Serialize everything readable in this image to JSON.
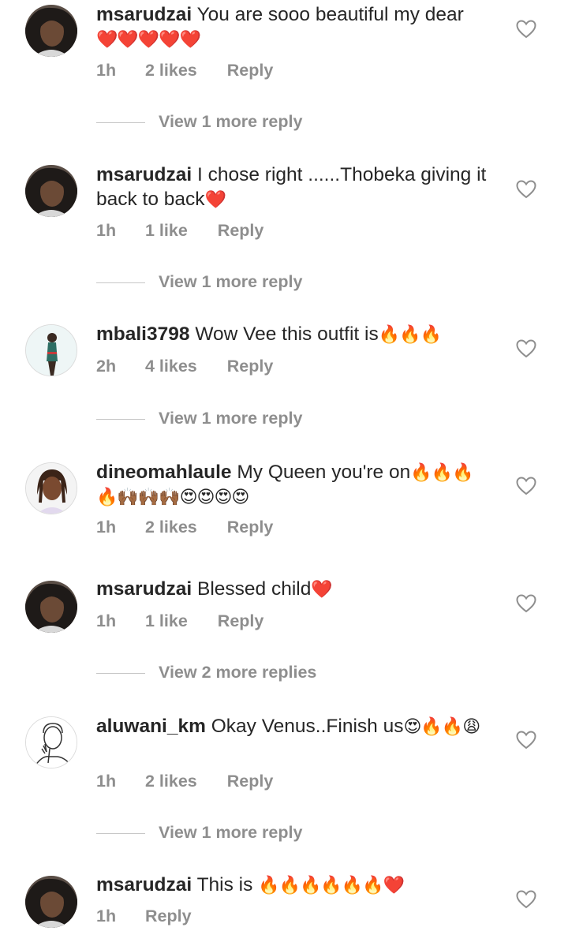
{
  "comments": [
    {
      "username": "msarudzai",
      "text": "You are sooo beautiful my dear",
      "emoji": "❤️❤️❤️❤️❤️",
      "time": "1h",
      "likes": "2 likes",
      "reply": "Reply",
      "view_more": "View 1 more reply",
      "avatar": "dark-hair-woman"
    },
    {
      "username": "msarudzai",
      "text": "I chose right ......Thobeka giving it back to back",
      "emoji": "❤️",
      "time": "1h",
      "likes": "1 like",
      "reply": "Reply",
      "view_more": "View 1 more reply",
      "avatar": "dark-hair-woman"
    },
    {
      "username": "mbali3798",
      "text": "Wow Vee this outfit is",
      "emoji": "🔥🔥🔥",
      "time": "2h",
      "likes": "4 likes",
      "reply": "Reply",
      "view_more": "View 1 more reply",
      "avatar": "standing-woman"
    },
    {
      "username": "dineomahlaule",
      "text": "My Queen  you're on",
      "emoji": "🔥🔥🔥🔥🙌🏾🙌🏾🙌🏾😍😍😍😍",
      "time": "1h",
      "likes": "2 likes",
      "reply": "Reply",
      "view_more": "",
      "avatar": "braided-woman"
    },
    {
      "username": "msarudzai",
      "text": "Blessed child",
      "emoji": "❤️",
      "time": "1h",
      "likes": "1 like",
      "reply": "Reply",
      "view_more": "View 2 more replies",
      "avatar": "dark-hair-woman"
    },
    {
      "username": "aluwani_km",
      "text": "Okay Venus..Finish us",
      "emoji": "😍🔥🔥😩",
      "time": "1h",
      "likes": "2 likes",
      "reply": "Reply",
      "view_more": "View 1 more reply",
      "avatar": "sketch-man"
    },
    {
      "username": "msarudzai",
      "text": "This is",
      "emoji": "🔥🔥🔥🔥🔥🔥❤️",
      "time": "1h",
      "likes": "",
      "reply": "Reply",
      "view_more": "",
      "avatar": "dark-hair-woman"
    }
  ],
  "icons": {
    "like": "heart-outline-icon"
  },
  "colors": {
    "text": "#262626",
    "meta": "#8e8e8e",
    "divider": "#c7c7c7"
  }
}
